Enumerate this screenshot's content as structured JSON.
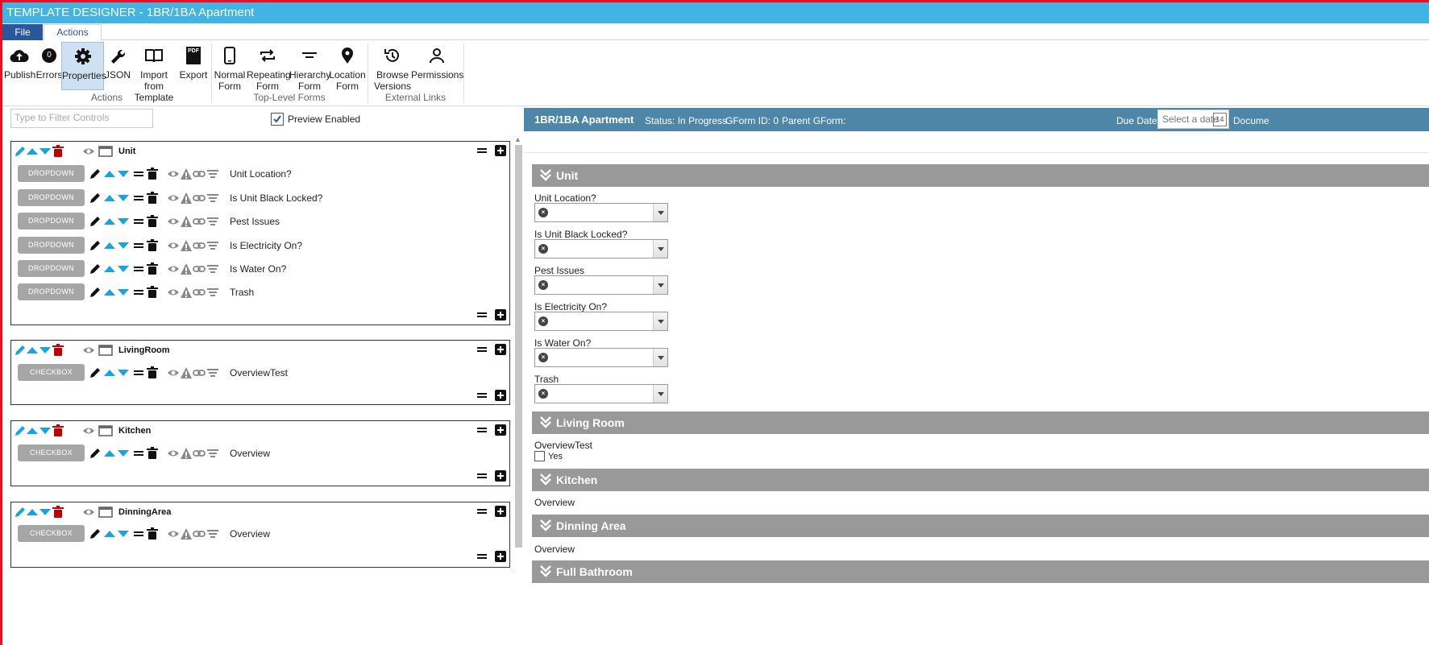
{
  "window": {
    "title": "TEMPLATE DESIGNER - 1BR/1BA Apartment"
  },
  "menu": {
    "file": "File",
    "actions": "Actions"
  },
  "ribbon": {
    "buttons": {
      "publish": "Publish",
      "errors": "Errors",
      "errors_count": "0",
      "properties": "Properties",
      "json": "JSON",
      "import_1": "Import from",
      "import_2": "Template",
      "export": "Export",
      "export_pdf": "PDF",
      "normal_1": "Normal",
      "normal_2": "Form",
      "repeating_1": "Repeating",
      "repeating_2": "Form",
      "hierarchy_1": "Hierarchy",
      "hierarchy_2": "Form",
      "location_1": "Location",
      "location_2": "Form",
      "browse_1": "Browse",
      "browse_2": "Versions",
      "permissions": "Permissions"
    },
    "groups": {
      "actions": "Actions",
      "top_level": "Top-Level Forms",
      "external": "External Links"
    }
  },
  "designer": {
    "filter_placeholder": "Type to Filter Controls",
    "preview_label": "Preview Enabled",
    "preview_checked": true,
    "sections": [
      {
        "name": "Unit",
        "controls": [
          {
            "type": "DROPDOWN",
            "label": "Unit Location?"
          },
          {
            "type": "DROPDOWN",
            "label": "Is Unit Black Locked?"
          },
          {
            "type": "DROPDOWN",
            "label": "Pest Issues"
          },
          {
            "type": "DROPDOWN",
            "label": "Is Electricity On?"
          },
          {
            "type": "DROPDOWN",
            "label": "Is Water On?"
          },
          {
            "type": "DROPDOWN",
            "label": "Trash"
          }
        ]
      },
      {
        "name": "LivingRoom",
        "controls": [
          {
            "type": "CHECKBOX",
            "label": "OverviewTest"
          }
        ]
      },
      {
        "name": "Kitchen",
        "controls": [
          {
            "type": "CHECKBOX",
            "label": "Overview"
          }
        ]
      },
      {
        "name": "DinningArea",
        "controls": [
          {
            "type": "CHECKBOX",
            "label": "Overview"
          }
        ]
      }
    ]
  },
  "preview": {
    "title": "1BR/1BA Apartment",
    "status": "Status:  In Progress",
    "gform_id": "GForm ID:  0",
    "parent": "Parent GForm:",
    "due_label": "Due Date:",
    "due_placeholder": "Select a date",
    "calendar_day": "14",
    "doc_cut": "Docume",
    "groups": {
      "unit": "Unit",
      "living": "Living Room",
      "kitchen": "Kitchen",
      "dinning": "Dinning Area",
      "bath": "Full Bathroom"
    },
    "unit_fields": [
      "Unit Location?",
      "Is Unit Black Locked?",
      "Pest Issues",
      "Is Electricity On?",
      "Is Water On?",
      "Trash"
    ],
    "living_field": "OverviewTest",
    "living_option": "Yes",
    "kitchen_field": "Overview",
    "dinning_field": "Overview"
  },
  "colors": {
    "titlebar": "#41b4e3",
    "file_tab": "#2b579a",
    "preview_header": "#4e86a7",
    "group_header": "#999999",
    "accent_blue": "#1aa3dd",
    "delete_red": "#c00000"
  }
}
